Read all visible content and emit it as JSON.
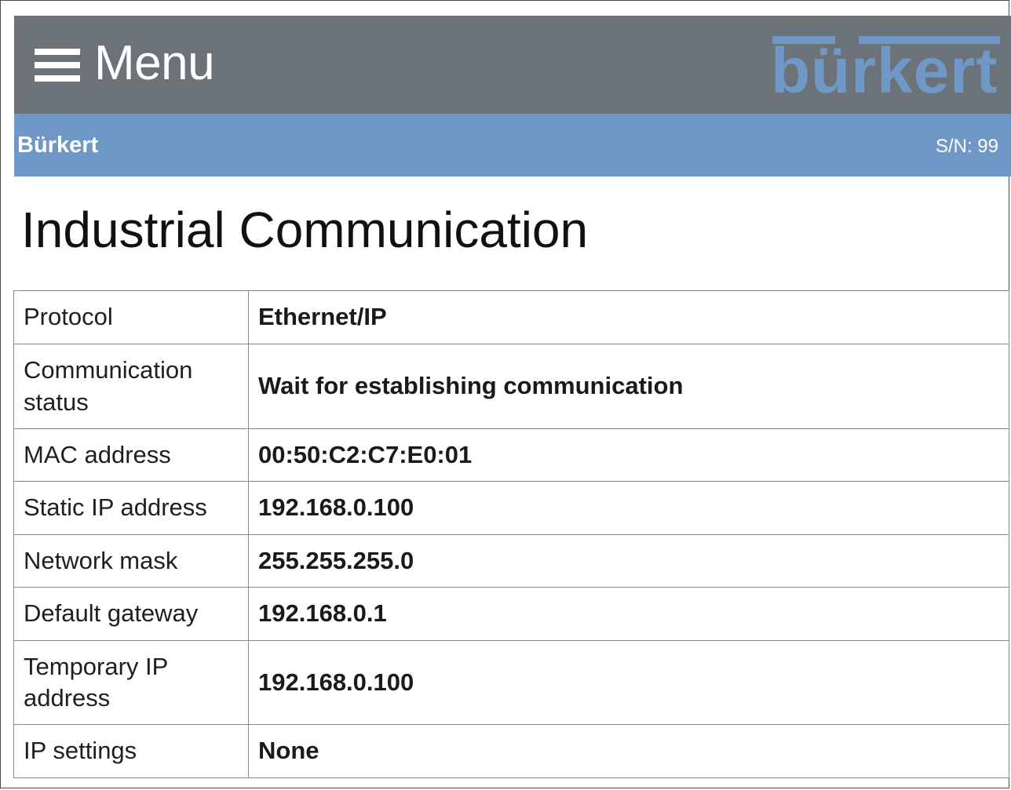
{
  "header": {
    "menu_label": "Menu",
    "logo_text": "bürkert",
    "brand_color": "#6f98c6",
    "header_bg": "#6b7378"
  },
  "subbar": {
    "brand": "Bürkert",
    "serial": "S/N: 99"
  },
  "page": {
    "title": "Industrial Communication"
  },
  "table": {
    "rows": [
      {
        "label": "Protocol",
        "value": "Ethernet/IP"
      },
      {
        "label": "Communication status",
        "value": "Wait for establishing communication"
      },
      {
        "label": "MAC address",
        "value": "00:50:C2:C7:E0:01"
      },
      {
        "label": "Static IP address",
        "value": "192.168.0.100"
      },
      {
        "label": "Network mask",
        "value": "255.255.255.0"
      },
      {
        "label": "Default gateway",
        "value": "192.168.0.1"
      },
      {
        "label": "Temporary IP address",
        "value": "192.168.0.100"
      },
      {
        "label": "IP settings",
        "value": "None"
      }
    ]
  }
}
